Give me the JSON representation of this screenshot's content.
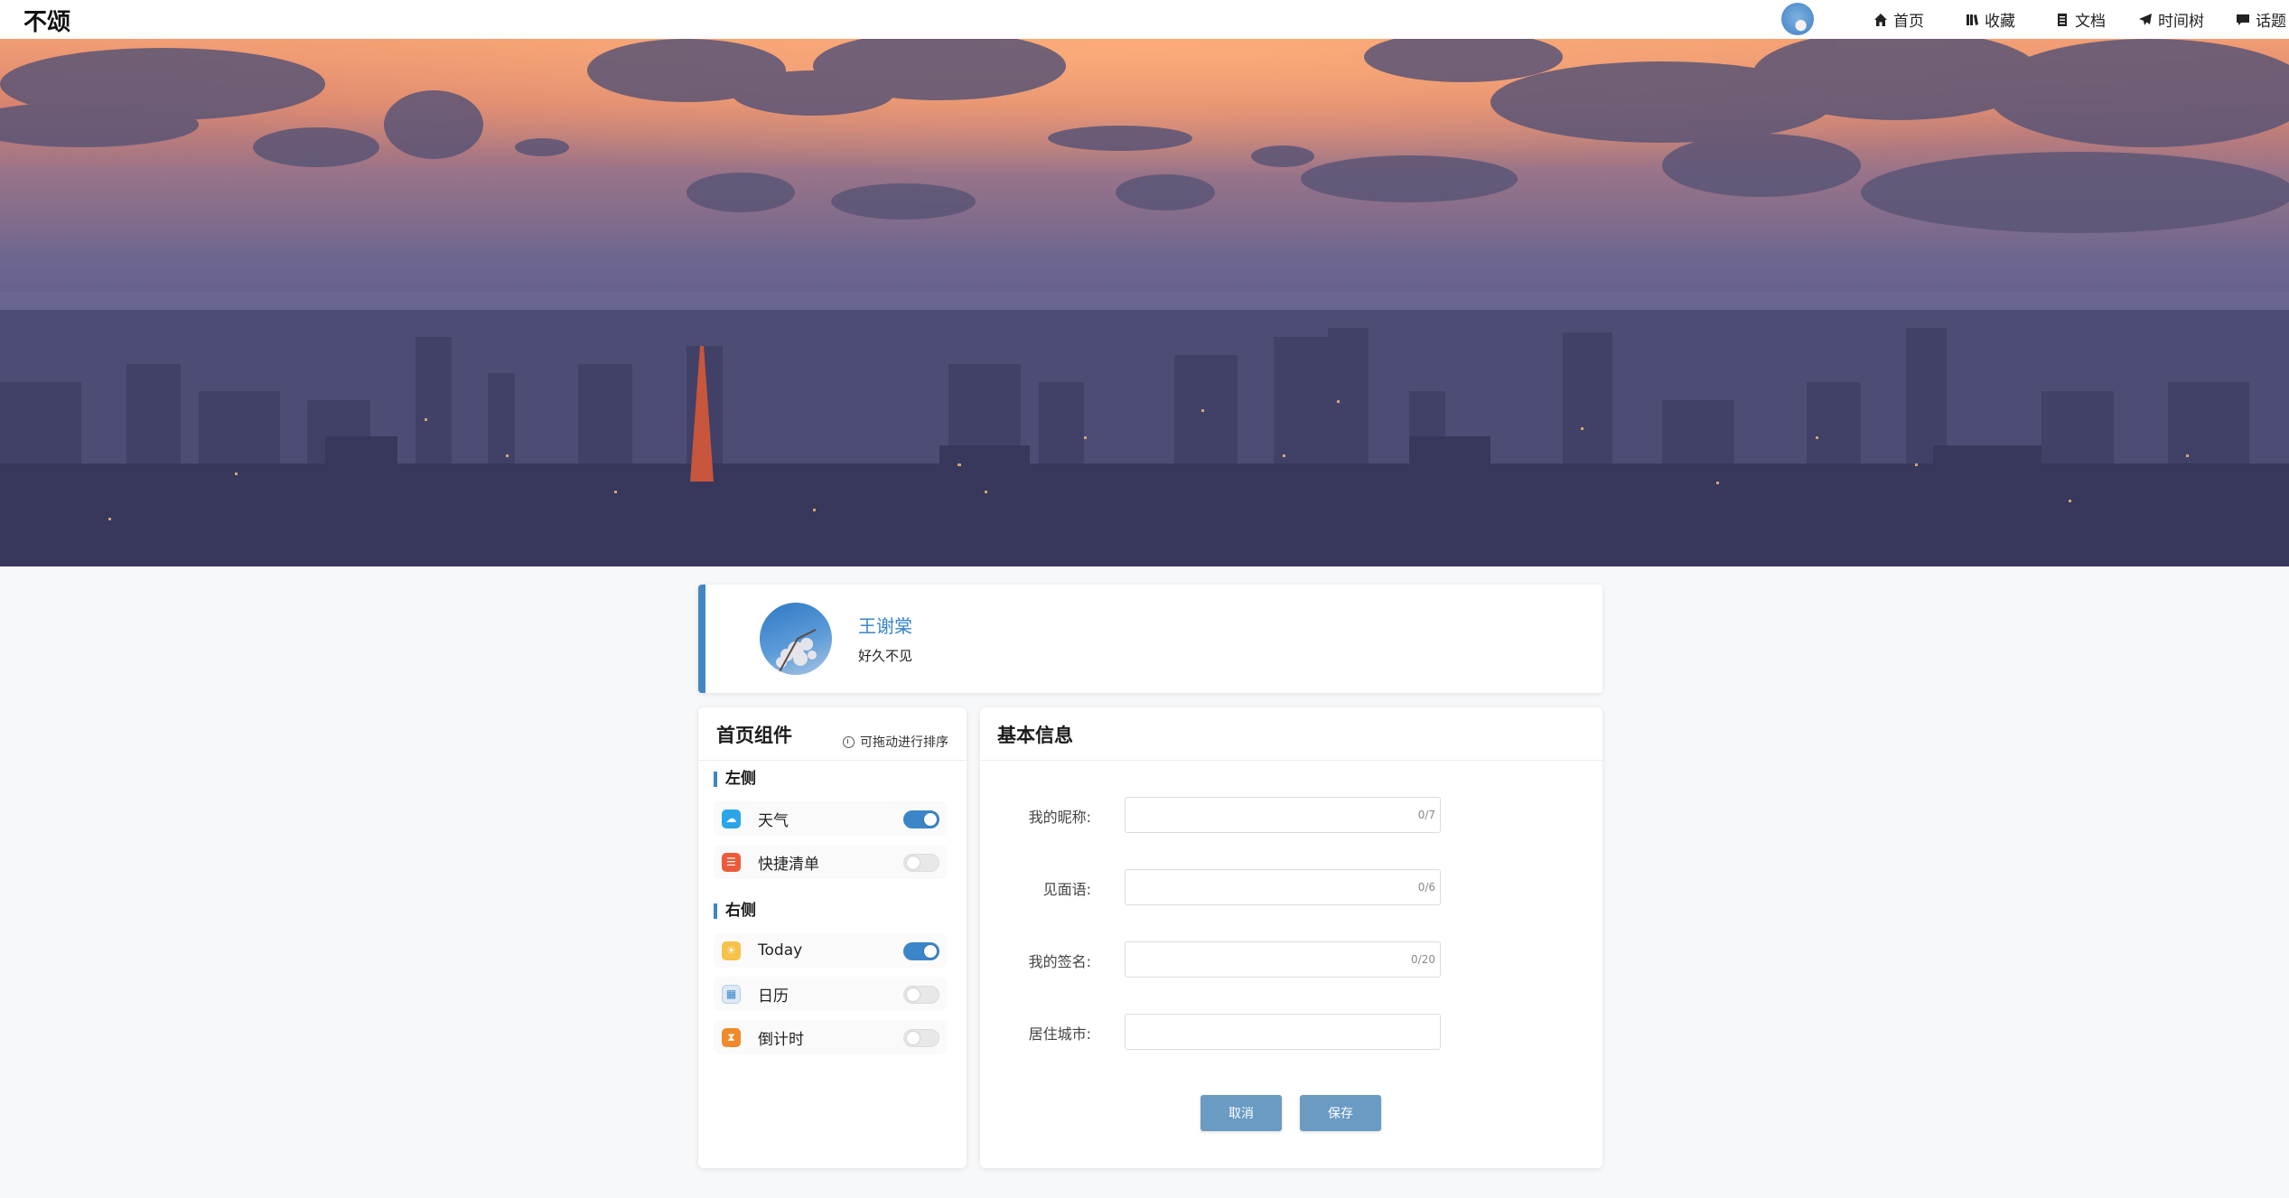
{
  "app": {
    "brand": "不颂"
  },
  "nav": [
    {
      "label": "首页",
      "icon": "home-icon"
    },
    {
      "label": "收藏",
      "icon": "bookmark-icon"
    },
    {
      "label": "文档",
      "icon": "document-icon"
    },
    {
      "label": "时间树",
      "icon": "paper-plane-icon"
    },
    {
      "label": "话题",
      "icon": "comment-icon"
    }
  ],
  "profile": {
    "name": "王谢棠",
    "greeting": "好久不见"
  },
  "widgets": {
    "title": "首页组件",
    "hint": "可拖动进行排序",
    "groups": [
      {
        "label": "左侧",
        "items": [
          {
            "label": "天气",
            "icon": "weather-icon",
            "enabled": true
          },
          {
            "label": "快捷清单",
            "icon": "checklist-icon",
            "enabled": false
          }
        ]
      },
      {
        "label": "右侧",
        "items": [
          {
            "label": "Today",
            "icon": "today-icon",
            "enabled": true
          },
          {
            "label": "日历",
            "icon": "calendar-icon",
            "enabled": false
          },
          {
            "label": "倒计时",
            "icon": "hourglass-icon",
            "enabled": false
          }
        ]
      }
    ]
  },
  "info": {
    "title": "基本信息",
    "fields": [
      {
        "label": "我的昵称:",
        "value": "",
        "counter": "0/7"
      },
      {
        "label": "见面语:",
        "value": "",
        "counter": "0/6"
      },
      {
        "label": "我的签名:",
        "value": "",
        "counter": "0/20"
      },
      {
        "label": "居住城市:",
        "value": "",
        "counter": ""
      }
    ],
    "cancel_label": "取消",
    "save_label": "保存"
  },
  "colors": {
    "accent": "#3b86c8",
    "button": "#6a9bc3",
    "background": "#f7f8f9"
  }
}
